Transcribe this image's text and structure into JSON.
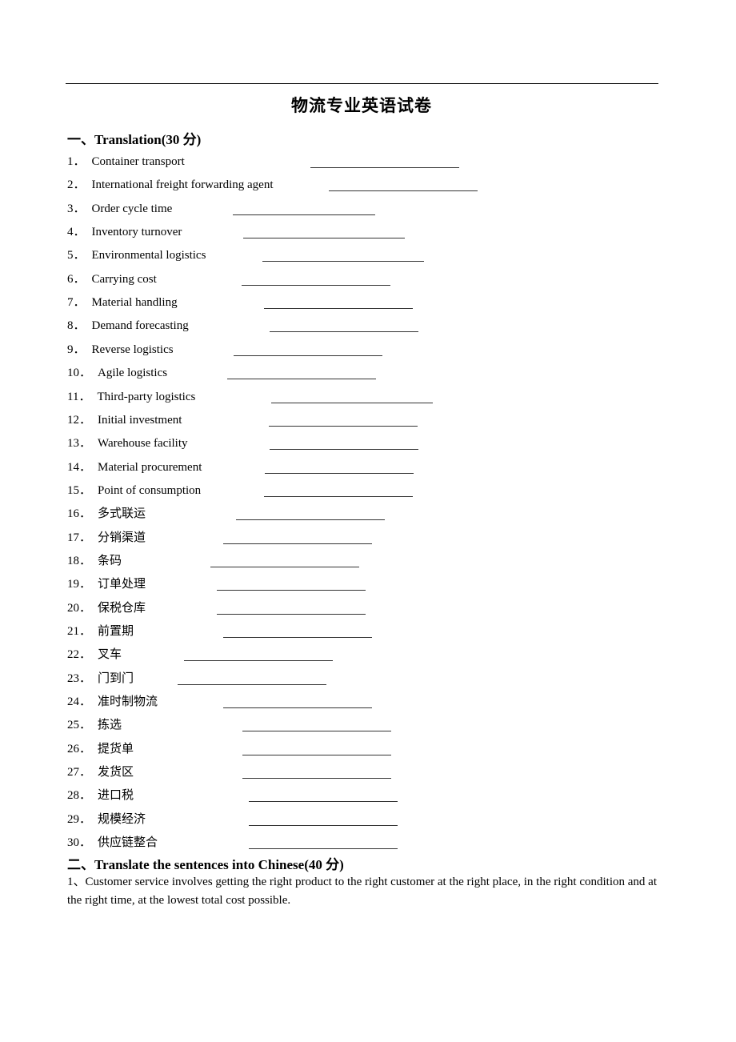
{
  "document": {
    "title": "物流专业英语试卷",
    "section1": {
      "heading": "一、Translation(30 分)",
      "items": [
        {
          "num": "1．",
          "term": "Container transport"
        },
        {
          "num": "2．",
          "term": "International freight forwarding agent"
        },
        {
          "num": "3．",
          "term": "Order cycle time"
        },
        {
          "num": "4．",
          "term": "Inventory turnover"
        },
        {
          "num": "5．",
          "term": "Environmental logistics"
        },
        {
          "num": "6．",
          "term": "Carrying cost"
        },
        {
          "num": "7．",
          "term": "Material handling"
        },
        {
          "num": "8．",
          "term": "Demand forecasting"
        },
        {
          "num": "9．",
          "term": "Reverse logistics"
        },
        {
          "num": "10．",
          "term": "Agile logistics"
        },
        {
          "num": "11．",
          "term": "Third-party logistics"
        },
        {
          "num": "12．",
          "term": "Initial investment"
        },
        {
          "num": "13．",
          "term": "Warehouse facility"
        },
        {
          "num": "14．",
          "term": "Material procurement"
        },
        {
          "num": "15．",
          "term": "Point of consumption"
        },
        {
          "num": "16．",
          "term": "多式联运"
        },
        {
          "num": "17．",
          "term": "分销渠道"
        },
        {
          "num": "18．",
          "term": "条码"
        },
        {
          "num": "19．",
          "term": "订单处理"
        },
        {
          "num": "20．",
          "term": "保税仓库"
        },
        {
          "num": "21．",
          "term": "前置期"
        },
        {
          "num": "22．",
          "term": "叉车"
        },
        {
          "num": "23．",
          "term": "门到门"
        },
        {
          "num": "24．",
          "term": "准时制物流"
        },
        {
          "num": "25．",
          "term": "拣选"
        },
        {
          "num": "26．",
          "term": "提货单"
        },
        {
          "num": "27．",
          "term": "发货区"
        },
        {
          "num": "28．",
          "term": "进口税"
        },
        {
          "num": "29．",
          "term": "规模经济"
        },
        {
          "num": "30．",
          "term": "供应链整合"
        }
      ]
    },
    "section2": {
      "heading": "二、Translate the sentences into Chinese(40 分)",
      "sentences": [
        {
          "num": "1、",
          "text": "Customer service involves getting the right product to the right customer at the right place, in the right condition and at the right time, at the lowest total cost possible."
        }
      ]
    }
  }
}
